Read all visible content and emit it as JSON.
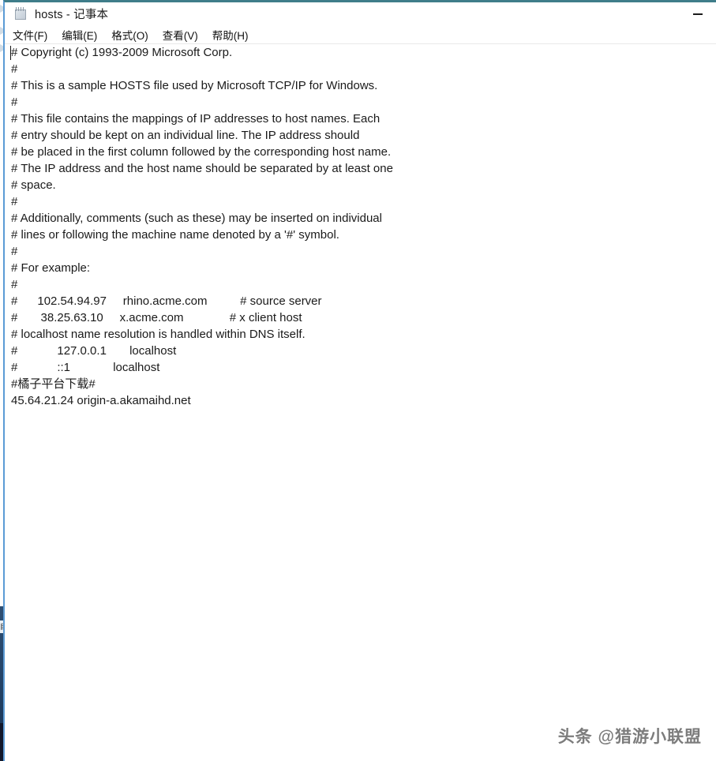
{
  "window": {
    "title": "hosts - 记事本",
    "icon": "notepad-icon",
    "minimize_label": "—",
    "accent_border": "#5b9bd5",
    "top_border": "#3f7d8a"
  },
  "menubar": {
    "items": [
      {
        "label": "文件(F)"
      },
      {
        "label": "编辑(E)"
      },
      {
        "label": "格式(O)"
      },
      {
        "label": "查看(V)"
      },
      {
        "label": "帮助(H)"
      }
    ]
  },
  "editor": {
    "lines": [
      "# Copyright (c) 1993-2009 Microsoft Corp.",
      "#",
      "# This is a sample HOSTS file used by Microsoft TCP/IP for Windows.",
      "#",
      "# This file contains the mappings of IP addresses to host names. Each",
      "# entry should be kept on an individual line. The IP address should",
      "# be placed in the first column followed by the corresponding host name.",
      "# The IP address and the host name should be separated by at least one",
      "# space.",
      "#",
      "# Additionally, comments (such as these) may be inserted on individual",
      "# lines or following the machine name denoted by a '#' symbol.",
      "#",
      "# For example:",
      "#",
      "#      102.54.94.97     rhino.acme.com          # source server",
      "#       38.25.63.10     x.acme.com              # x client host",
      "# localhost name resolution is handled within DNS itself.",
      "#            127.0.0.1       localhost",
      "#            ::1             localhost",
      "#橘子平台下载#",
      "45.64.21.24 origin-a.akamaihd.net"
    ]
  },
  "watermark": {
    "text": "头条 @猎游小联盟"
  },
  "desktop": {
    "tab_fragment": "目"
  }
}
